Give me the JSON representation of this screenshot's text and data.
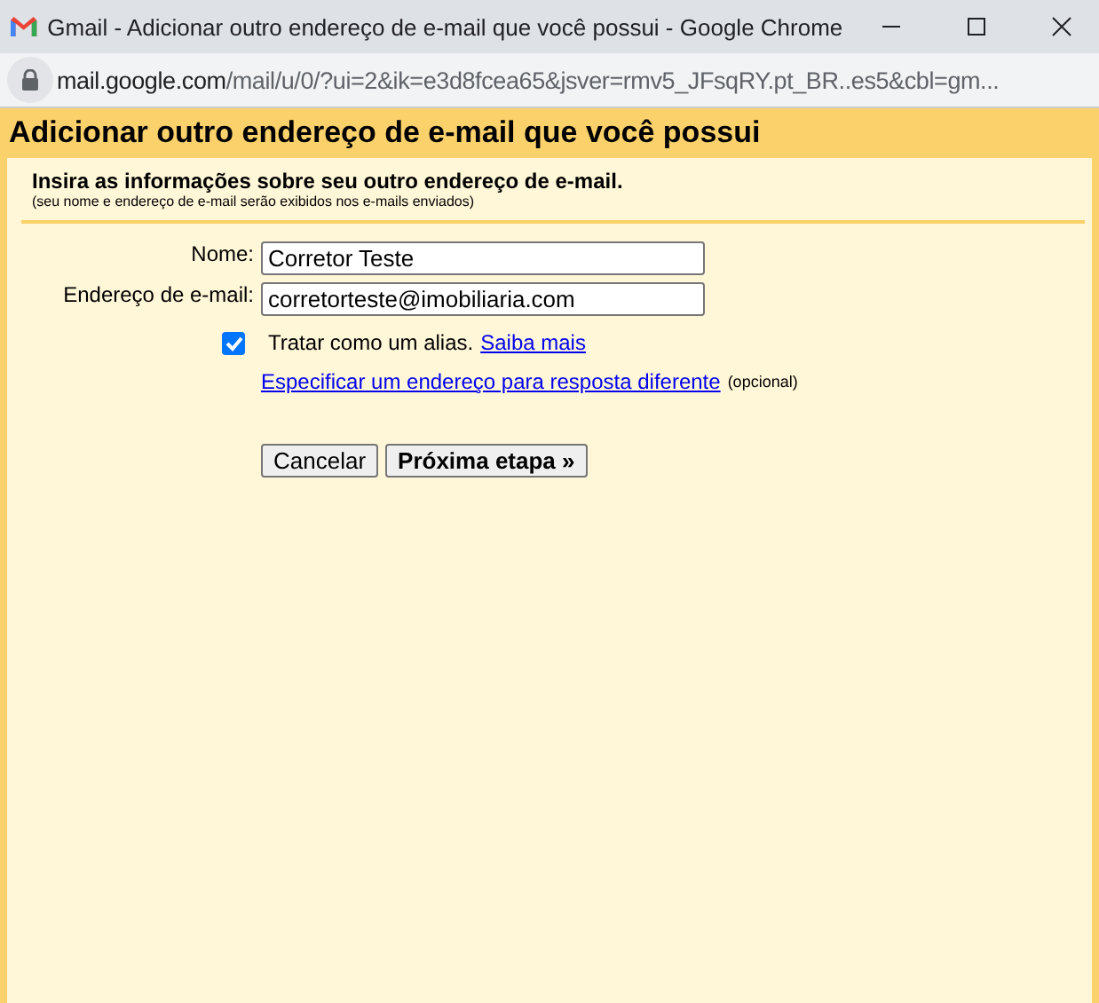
{
  "window": {
    "title": "Gmail - Adicionar outro endereço de e-mail que você possui - Google Chrome"
  },
  "address_bar": {
    "host": "mail.google.com",
    "path": "/mail/u/0/?ui=2&ik=e3d8fcea65&jsver=rmv5_JFsqRY.pt_BR..es5&cbl=gm..."
  },
  "heading": "Adicionar outro endereço de e-mail que você possui",
  "intro": {
    "title": "Insira as informações sobre seu outro endereço de e-mail.",
    "note": "(seu nome e endereço de e-mail serão exibidos nos e-mails enviados)"
  },
  "fields": [
    {
      "label": "Nome:",
      "value": "Corretor Teste"
    },
    {
      "label": "Endereço de e-mail:",
      "value": "corretorteste@imobiliaria.com"
    }
  ],
  "alias": {
    "label": "Tratar como um alias.",
    "checked": true,
    "link": "Saiba mais"
  },
  "reply_to": {
    "link": "Especificar um endereço para resposta diferente",
    "note": "(opcional)"
  },
  "buttons": [
    {
      "label": "Cancelar",
      "primary": false
    },
    {
      "label": "Próxima etapa »",
      "primary": true
    }
  ]
}
